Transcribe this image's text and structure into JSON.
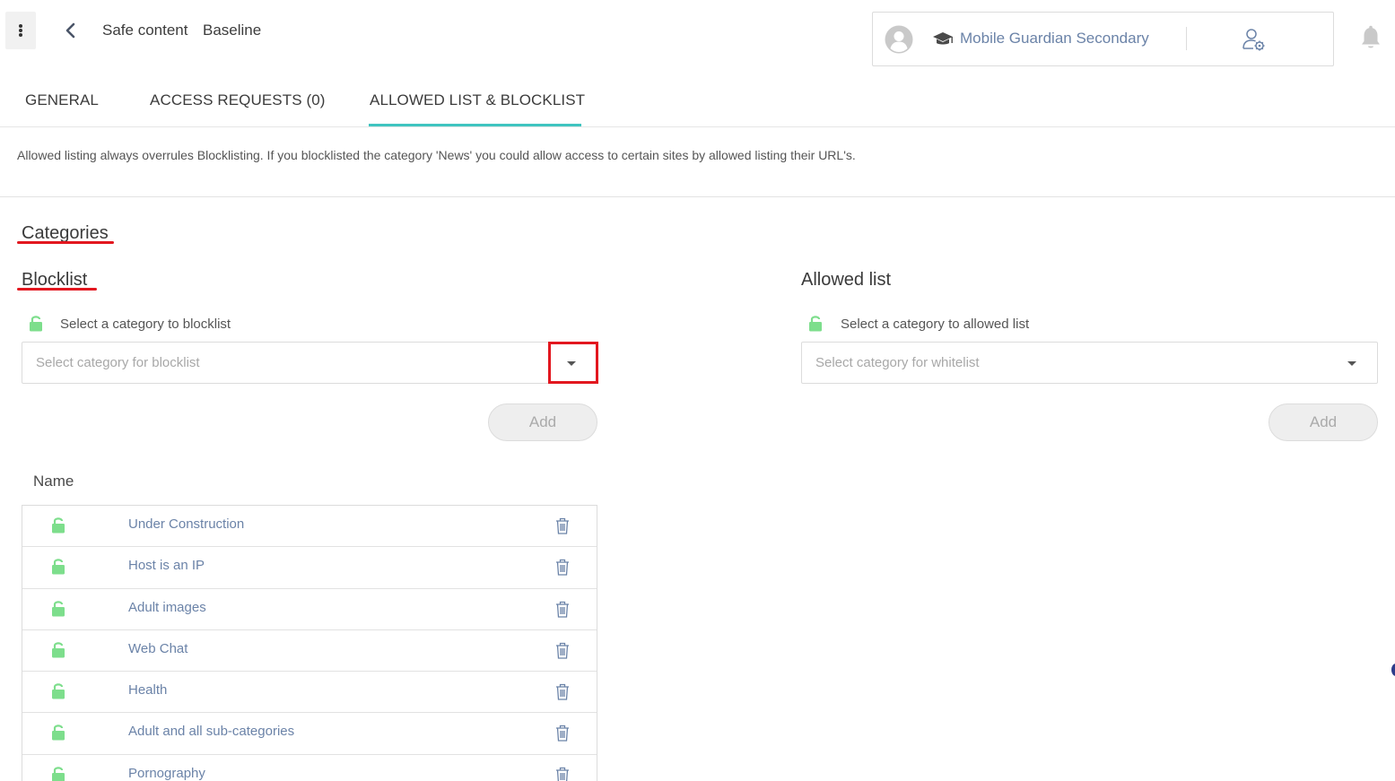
{
  "header": {
    "breadcrumb": [
      "Safe content",
      "Baseline"
    ],
    "school_name": "Mobile Guardian Secondary"
  },
  "tabs": [
    {
      "label": "GENERAL",
      "active": false
    },
    {
      "label": "ACCESS REQUESTS (0)",
      "active": false
    },
    {
      "label": "ALLOWED LIST & BLOCKLIST",
      "active": true
    }
  ],
  "info_text": "Allowed listing always overrules Blocklisting. If you blocklisted the category 'News' you could allow access to certain sites by allowed listing their URL's.",
  "categories_heading": "Categories",
  "blocklist": {
    "heading": "Blocklist",
    "select_label": "Select a category to blocklist",
    "placeholder": "Select category for blocklist",
    "add_label": "Add"
  },
  "allowed": {
    "heading": "Allowed list",
    "select_label": "Select a category to allowed list",
    "placeholder": "Select category for whitelist",
    "add_label": "Add"
  },
  "table": {
    "column_name": "Name",
    "rows": [
      "Under Construction",
      "Host is an IP",
      "Adult images",
      "Web Chat",
      "Health",
      "Adult and all sub-categories",
      "Pornography"
    ]
  },
  "colors": {
    "accent_tab": "#3fc4c0",
    "highlight": "#e2171f",
    "lock_green": "#7dde8c",
    "link_blue": "#6b83a8"
  },
  "icons": {
    "menu": "vertical-dots-icon",
    "back": "chevron-left-icon",
    "avatar": "user-circle-icon",
    "school": "graduation-cap-icon",
    "settings": "user-settings-icon",
    "bell": "bell-icon",
    "lock": "unlock-icon",
    "trash": "trash-icon",
    "caret": "caret-down-icon"
  }
}
